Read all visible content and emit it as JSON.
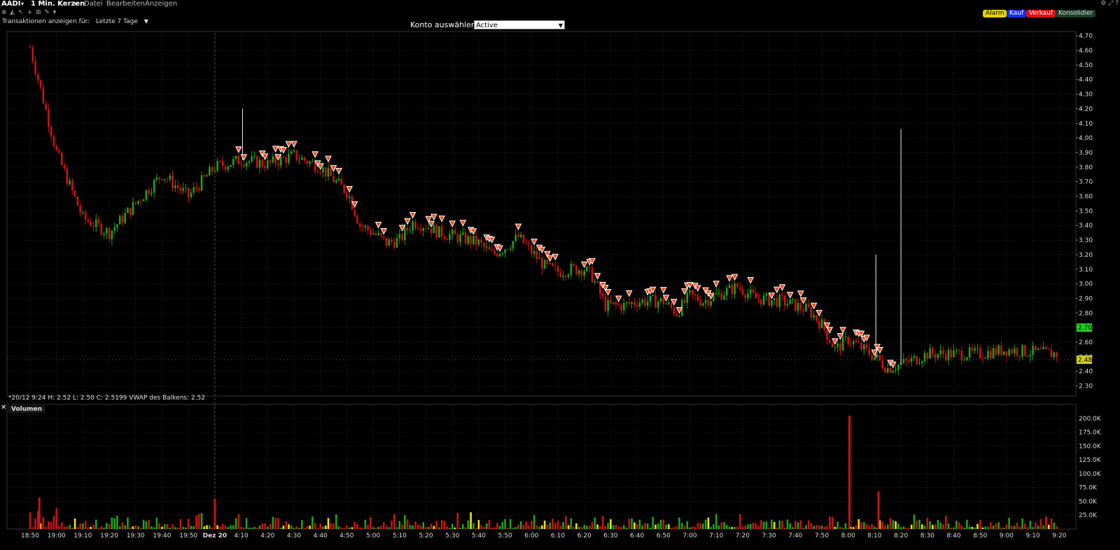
{
  "menubar": {
    "symbol": "AADI",
    "chart_type": "1 Min. Kerzen",
    "menus": [
      "Datei",
      "Bearbeiten",
      "Anzeigen"
    ]
  },
  "toolbar": {
    "transactions_label": "Transaktionen anzeigen für:",
    "transactions_value": "Letzte 7 Tage",
    "konto_label": "Konto auswählen",
    "konto_value": "Active"
  },
  "buttons": {
    "alarm": "Alarm",
    "buy": "Kauf",
    "sell": "Verkauf",
    "consolidate": "Konsolidier"
  },
  "colors": {
    "up": "#1fa01f",
    "down": "#c81414",
    "neutral_volume": "#e8e020",
    "sell_marker": "#e8501e",
    "last_price_bg": "#1fd01f",
    "current_price_bg": "#d0d020",
    "grid": "#2a2a2a"
  },
  "price_panel": {
    "ohlc_text": "*20/12 9:24  H: 2.52  L: 2.50  C: 2.5199  VWAP des Balkens: 2.52",
    "last_price_tag": "2.70",
    "current_price_tag": "2.48"
  },
  "volume_panel": {
    "label": "Volumen"
  },
  "chart_data": [
    {
      "type": "candlestick",
      "title": "AADI 1 Min. Kerzen",
      "y_ticks": [
        "4.70",
        "4.60",
        "4.50",
        "4.40",
        "4.30",
        "4.20",
        "4.10",
        "4.00",
        "3.90",
        "3.80",
        "3.70",
        "3.60",
        "3.50",
        "3.40",
        "3.30",
        "3.20",
        "3.10",
        "3.00",
        "2.90",
        "2.80",
        "2.70",
        "2.60",
        "2.50",
        "2.40",
        "2.30"
      ],
      "ylim": [
        2.25,
        4.72
      ],
      "x_ticks": [
        "18:50",
        "19:00",
        "19:10",
        "19:20",
        "19:30",
        "19:40",
        "19:50",
        "Dez 20",
        "4:10",
        "4:20",
        "4:30",
        "4:40",
        "4:50",
        "5:00",
        "5:10",
        "5:20",
        "5:30",
        "5:40",
        "5:50",
        "6:00",
        "6:10",
        "6:20",
        "6:30",
        "6:40",
        "6:50",
        "7:00",
        "7:10",
        "7:20",
        "7:30",
        "7:40",
        "7:50",
        "8:00",
        "8:10",
        "8:20",
        "8:30",
        "8:40",
        "8:50",
        "9:00",
        "9:10",
        "9:20"
      ],
      "price_path": [
        [
          0,
          4.62
        ],
        [
          1,
          3.9
        ],
        [
          2,
          3.45
        ],
        [
          3,
          3.35
        ],
        [
          4,
          3.55
        ],
        [
          5,
          3.75
        ],
        [
          6,
          3.6
        ],
        [
          7,
          3.8
        ],
        [
          8,
          3.85
        ],
        [
          9,
          3.82
        ],
        [
          10,
          3.88
        ],
        [
          11,
          3.8
        ],
        [
          12.05,
          3.62
        ],
        [
          12.5,
          3.4
        ],
        [
          13,
          3.35
        ],
        [
          13.5,
          3.28
        ],
        [
          14,
          3.3
        ],
        [
          14.5,
          3.42
        ],
        [
          15,
          3.4
        ],
        [
          15.5,
          3.35
        ],
        [
          16,
          3.33
        ],
        [
          17,
          3.28
        ],
        [
          17.5,
          3.2
        ],
        [
          18,
          3.25
        ],
        [
          18.5,
          3.32
        ],
        [
          19,
          3.22
        ],
        [
          19.5,
          3.12
        ],
        [
          20,
          3.08
        ],
        [
          20.5,
          3.1
        ],
        [
          21,
          3.1
        ],
        [
          21.3,
          3.05
        ],
        [
          21.8,
          2.85
        ],
        [
          22.5,
          2.85
        ],
        [
          23,
          2.88
        ],
        [
          24,
          2.88
        ],
        [
          24.5,
          2.8
        ],
        [
          25,
          2.92
        ],
        [
          25.5,
          2.88
        ],
        [
          26,
          2.92
        ],
        [
          26.8,
          2.98
        ],
        [
          27.5,
          2.9
        ],
        [
          28.5,
          2.88
        ],
        [
          29,
          2.85
        ],
        [
          29.5,
          2.82
        ],
        [
          30,
          2.72
        ],
        [
          30.5,
          2.55
        ],
        [
          31,
          2.62
        ],
        [
          32,
          2.5
        ],
        [
          32.5,
          2.42
        ],
        [
          33,
          2.45
        ],
        [
          33.5,
          2.48
        ],
        [
          34,
          2.52
        ],
        [
          35,
          2.52
        ],
        [
          36,
          2.52
        ],
        [
          37,
          2.55
        ],
        [
          38,
          2.53
        ],
        [
          39,
          2.52
        ]
      ],
      "spikes": [
        [
          32.05,
          3.2
        ],
        [
          33.0,
          4.06
        ],
        [
          8.05,
          4.2
        ]
      ],
      "sell_markers": "dense on the down-trend from Dez 20 4:10 to 8:20"
    },
    {
      "type": "bar",
      "title": "Volumen",
      "y_ticks": [
        "200.0K",
        "175.0K",
        "150.0K",
        "125.0K",
        "100.0K",
        "75.0K",
        "50.0K",
        "25.0K"
      ],
      "ylim": [
        0,
        210000
      ],
      "highlights": [
        {
          "x": "8:00",
          "value": 205000
        },
        {
          "x": "8:10",
          "value": 68000
        },
        {
          "x": "Dez 20",
          "value": 55000
        },
        {
          "x": "18:50",
          "value": 57000
        }
      ]
    }
  ]
}
